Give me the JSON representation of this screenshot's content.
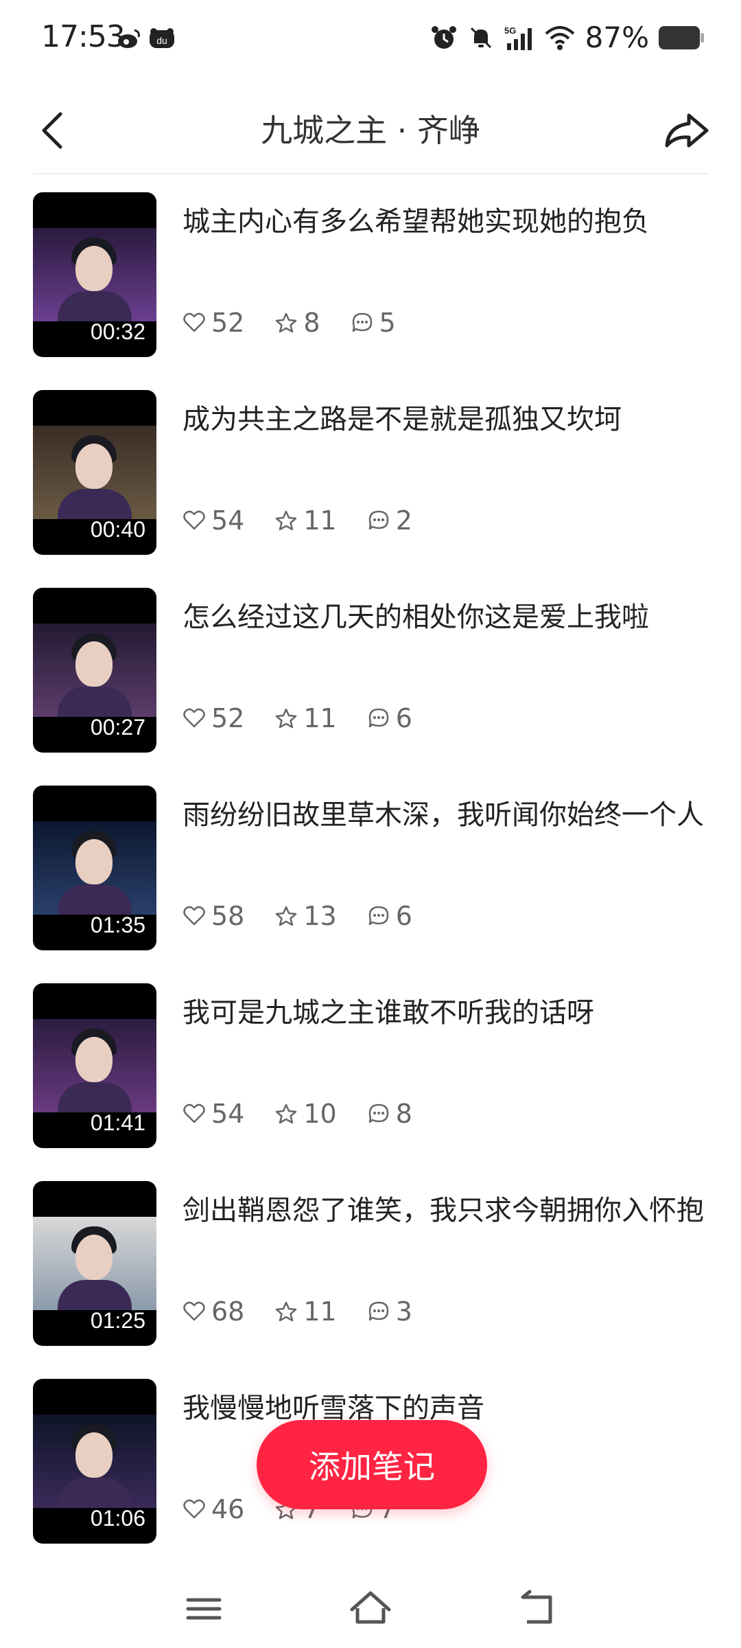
{
  "status_bar": {
    "time": "17:53",
    "battery": "87%",
    "left_icons": [
      "weibo-icon",
      "du-app-icon"
    ],
    "right_icons": [
      "alarm-icon",
      "mute-icon",
      "5g-signal-icon",
      "wifi-icon",
      "battery-icon"
    ]
  },
  "header": {
    "title": "九城之主 · 齐峥",
    "back_icon": "chevron-left-icon",
    "share_icon": "share-icon"
  },
  "items": [
    {
      "title": "城主内心有多么希望帮她实现她的抱负",
      "duration": "00:32",
      "likes": "52",
      "stars": "8",
      "comments": "5"
    },
    {
      "title": "成为共主之路是不是就是孤独又坎坷",
      "duration": "00:40",
      "likes": "54",
      "stars": "11",
      "comments": "2"
    },
    {
      "title": "怎么经过这几天的相处你这是爱上我啦",
      "duration": "00:27",
      "likes": "52",
      "stars": "11",
      "comments": "6"
    },
    {
      "title": "雨纷纷旧故里草木深，我听闻你始终一个人",
      "duration": "01:35",
      "likes": "58",
      "stars": "13",
      "comments": "6"
    },
    {
      "title": "我可是九城之主谁敢不听我的话呀",
      "duration": "01:41",
      "likes": "54",
      "stars": "10",
      "comments": "8"
    },
    {
      "title": "剑出鞘恩怨了谁笑，我只求今朝拥你入怀抱",
      "duration": "01:25",
      "likes": "68",
      "stars": "11",
      "comments": "3"
    },
    {
      "title": "我慢慢地听雪落下的声音",
      "duration": "01:06",
      "likes": "46",
      "stars": "7",
      "comments": "7"
    }
  ],
  "floating_button": {
    "label": "添加笔记"
  },
  "colors": {
    "accent": "#ff2442",
    "text": "#222222",
    "muted": "#666666"
  },
  "nav": [
    "menu-icon",
    "home-icon",
    "back-icon"
  ]
}
